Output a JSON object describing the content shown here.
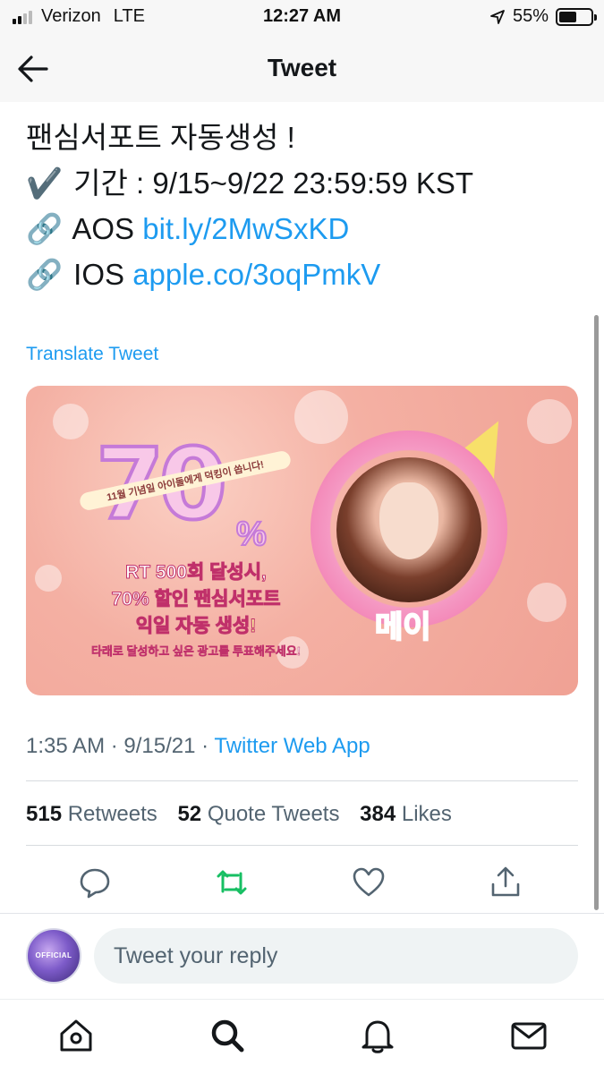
{
  "status_bar": {
    "carrier": "Verizon",
    "network": "LTE",
    "time": "12:27 AM",
    "battery_percent": "55%",
    "battery_level": 0.55,
    "signal_bars": 2
  },
  "header": {
    "title": "Tweet",
    "back_icon": "arrow-left-icon"
  },
  "tweet": {
    "lines": [
      {
        "prefix": "",
        "text": "팬심서포트 자동생성 !",
        "link": ""
      },
      {
        "prefix": "✔️",
        "text": "기간 : 9/15~9/22 23:59:59 KST",
        "link": ""
      },
      {
        "prefix": "🔗",
        "text": "AOS",
        "link": "bit.ly/2MwSxKD"
      },
      {
        "prefix": "🔗",
        "text": "IOS",
        "link": "apple.co/3oqPmkV"
      }
    ],
    "translate_label": "Translate Tweet",
    "media": {
      "big_number": "70",
      "percent_sign": "%",
      "caption": "11월 기념일 아이돌에게 덕킹이 쏩니다!",
      "line1": "RT 500회 달성시,",
      "line2": "70% 할인 팬심서포트",
      "line3": "익일 자동 생성!",
      "line4": "타래로 달성하고 싶은 광고를 투표해주세요!",
      "name": "메이"
    },
    "time": "1:35 AM",
    "date": "9/15/21",
    "separator": "·",
    "source": "Twitter Web App",
    "stats": {
      "retweets_count": "515",
      "retweets_label": "Retweets",
      "quotes_count": "52",
      "quotes_label": "Quote Tweets",
      "likes_count": "384",
      "likes_label": "Likes"
    },
    "actions": [
      "reply-icon",
      "retweet-icon",
      "like-icon",
      "share-icon"
    ]
  },
  "reply": {
    "placeholder": "Tweet your reply",
    "avatar_text": "OFFICIAL"
  },
  "tabs": [
    "home-icon",
    "search-icon",
    "notifications-icon",
    "messages-icon"
  ],
  "colors": {
    "accent": "#1d9bf0",
    "retweet_green": "#17bf63",
    "text_primary": "#14171a",
    "text_secondary": "#536471"
  }
}
